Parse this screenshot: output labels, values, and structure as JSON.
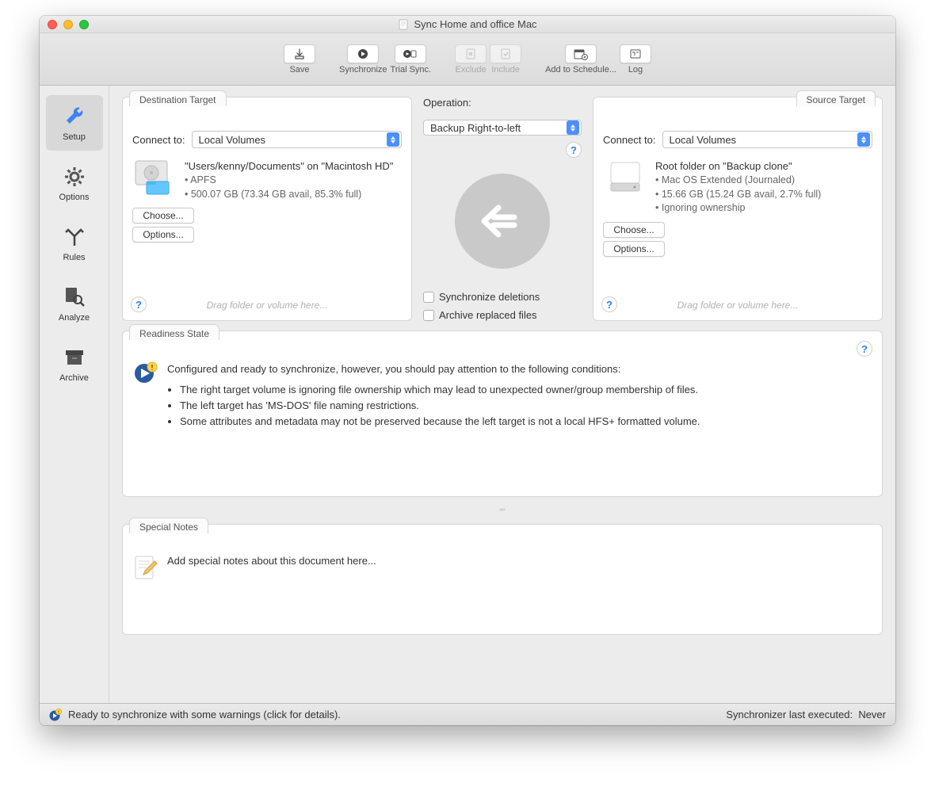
{
  "window": {
    "title": "Sync Home and office Mac"
  },
  "toolbar": {
    "save": "Save",
    "synchronize": "Synchronize",
    "trial": "Trial Sync.",
    "exclude": "Exclude",
    "include": "Include",
    "schedule": "Add to Schedule...",
    "log": "Log"
  },
  "sidebar": {
    "setup": "Setup",
    "options": "Options",
    "rules": "Rules",
    "analyze": "Analyze",
    "archive": "Archive"
  },
  "dest": {
    "tab": "Destination Target",
    "connectLabel": "Connect to:",
    "connectValue": "Local Volumes",
    "title": "\"Users/kenny/Documents\" on \"Macintosh HD\"",
    "b1": "• APFS",
    "b2": "• 500.07 GB (73.34 GB avail, 85.3% full)",
    "choose": "Choose...",
    "options": "Options...",
    "hint": "Drag folder or volume here..."
  },
  "src": {
    "tab": "Source Target",
    "connectLabel": "Connect to:",
    "connectValue": "Local Volumes",
    "title": "Root folder on \"Backup clone\"",
    "b1": "• Mac OS Extended (Journaled)",
    "b2": "• 15.66 GB (15.24 GB avail, 2.7% full)",
    "b3": "• Ignoring ownership",
    "choose": "Choose...",
    "options": "Options...",
    "hint": "Drag folder or volume here..."
  },
  "op": {
    "label": "Operation:",
    "value": "Backup Right-to-left",
    "syncDel": "Synchronize deletions",
    "archive": "Archive replaced files"
  },
  "readiness": {
    "tab": "Readiness State",
    "headline": "Configured and ready to synchronize, however, you should pay attention to the following conditions:",
    "c1": "The right target volume is ignoring file ownership which may lead to unexpected owner/group membership of files.",
    "c2": "The left target has 'MS-DOS' file naming restrictions.",
    "c3": "Some attributes and metadata may not be preserved because the left target is not a local HFS+ formatted volume."
  },
  "notes": {
    "tab": "Special Notes",
    "placeholder": "Add special notes about this document here..."
  },
  "status": {
    "left": "Ready to synchronize with some warnings (click for details).",
    "rightLabel": "Synchronizer last executed:",
    "rightValue": "Never"
  },
  "help": "?"
}
